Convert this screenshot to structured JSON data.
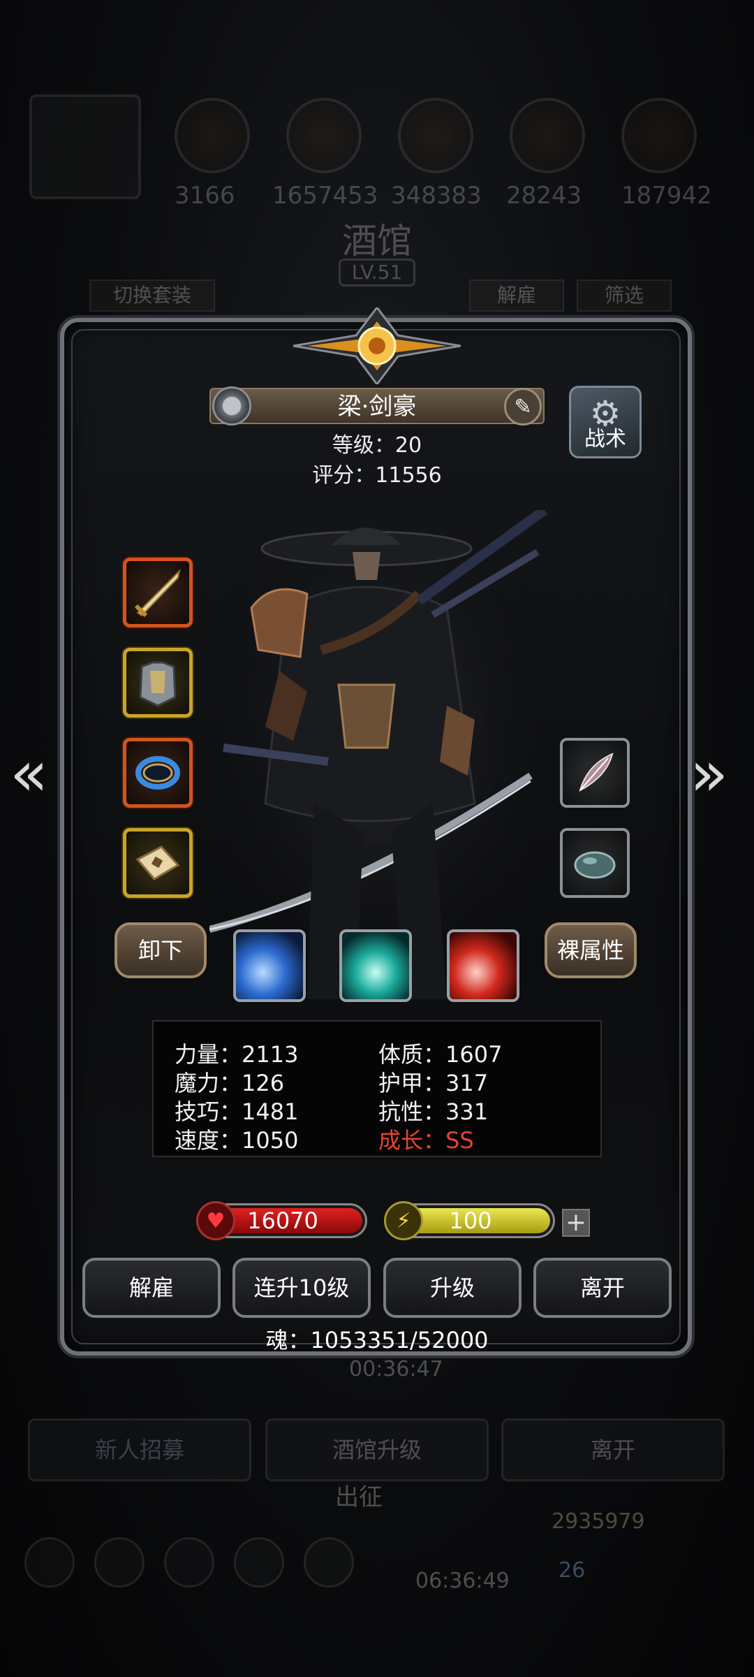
{
  "background": {
    "resources": [
      "3166",
      "1657453",
      "348383",
      "28243",
      "187942"
    ],
    "title": "酒馆",
    "level": "LV.51",
    "switch_set_label": "切换套装",
    "dismiss_label": "解雇",
    "filter_label": "筛选",
    "timer_top": "00:36:47",
    "bottom_buttons": [
      "新人招募",
      "酒馆升级",
      "离开"
    ],
    "expedition_label": "出征",
    "gold": "2935979",
    "gems": "26",
    "timer_bottom": "06:36:49"
  },
  "hero": {
    "name": "梁·剑豪",
    "level_text": "等级：20",
    "score_text": "评分：11556",
    "tactics_label": "战术"
  },
  "controls": {
    "unequip_label": "卸下",
    "naked_attr_label": "裸属性"
  },
  "stats": {
    "left": [
      "力量：2113",
      "魔力：126",
      "技巧：1481",
      "速度：1050"
    ],
    "right": [
      "体质：1607",
      "护甲：317",
      "抗性：331",
      "成长：SS"
    ]
  },
  "bars": {
    "hp": "16070",
    "energy": "100",
    "energy_fill": 1.0
  },
  "actions": [
    "解雇",
    "连升10级",
    "升级",
    "离开"
  ],
  "soul_text": "魂：1053351/52000",
  "colors": {
    "growth": "#e2452a",
    "hp": "#c01515",
    "energy": "#d8d020",
    "slot_orange": "#d2541e",
    "slot_gold": "#c9a42a"
  }
}
